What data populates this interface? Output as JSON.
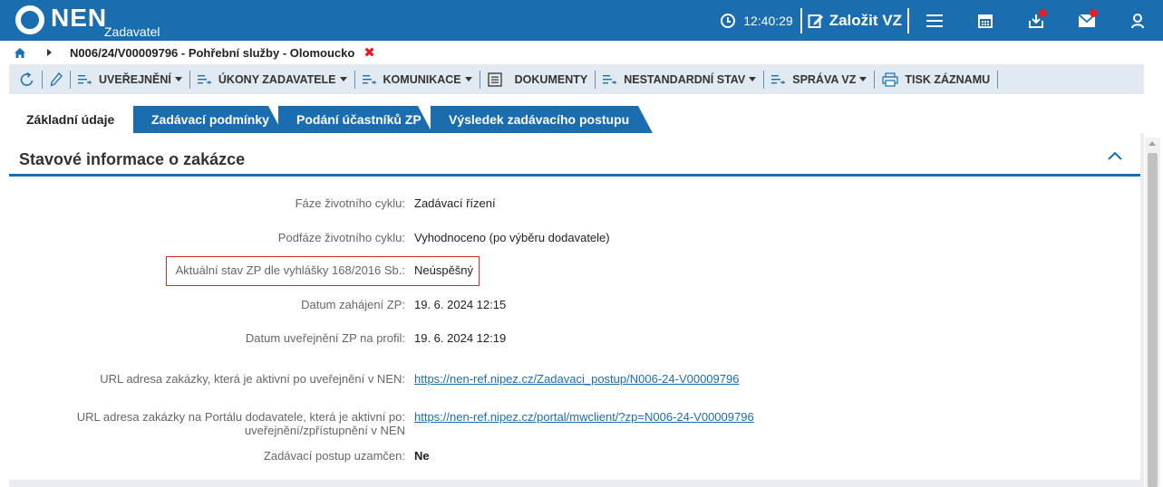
{
  "app": {
    "brand": "NEN",
    "role": "Zadavatel"
  },
  "header": {
    "time": "12:40:29",
    "create_label": "Založit VZ",
    "icons": [
      "clock-icon",
      "edit-icon",
      "menu-icon",
      "calendar-icon",
      "inbox-download-icon",
      "mail-icon",
      "user-icon"
    ]
  },
  "breadcrumb": {
    "label": "N006/24/V00009796 - Pohřební služby - Olomoucko",
    "close": "✖"
  },
  "toolbar": {
    "uverejneni": "UVEŘEJNĚNÍ",
    "ukony": "ÚKONY ZADAVATELE",
    "komunikace": "KOMUNIKACE",
    "dokumenty": "DOKUMENTY",
    "nestandardni": "NESTANDARDNÍ STAV",
    "sprava": "SPRÁVA VZ",
    "tisk": "TISK ZÁZNAMU"
  },
  "tabs": [
    "Základní údaje",
    "Zadávací podmínky",
    "Podání účastníků ZP",
    "Výsledek zadávacího postupu"
  ],
  "section": {
    "title": "Stavové informace o zakázce",
    "fields": [
      {
        "label": "Fáze životního cyklu:",
        "value": "Zadávací řízení"
      },
      {
        "label": "Podfáze životního cyklu:",
        "value": "Vyhodnoceno (po výběru dodavatele)"
      },
      {
        "label": "Aktuální stav ZP dle vyhlášky 168/2016 Sb.:",
        "value": "Neúspěšný"
      },
      {
        "label": "Datum zahájení ZP:",
        "value": "19. 6. 2024 12:15"
      },
      {
        "label": "Datum uveřejnění ZP na profil:",
        "value": "19. 6. 2024 12:19"
      },
      {
        "label": "URL adresa zakázky, která je aktivní po uveřejnění v NEN:",
        "value": "https://nen-ref.nipez.cz/Zadavaci_postup/N006-24-V00009796"
      },
      {
        "label_line1": "URL adresa zakázky na Portálu dodavatele, která je aktivní po:",
        "label_line2": "uveřejnění/zpřístupnění v NEN",
        "value": "https://nen-ref.nipez.cz/portal/mwclient/?zp=N006-24-V00009796"
      },
      {
        "label": "Zadávací postup uzamčen:",
        "value": "Ne"
      }
    ]
  },
  "colors": {
    "brand_blue": "#1a6eb0",
    "toolbar_bg": "#e1e9f1",
    "highlight_red": "#d32f2f",
    "badge_red": "#e41e25"
  }
}
